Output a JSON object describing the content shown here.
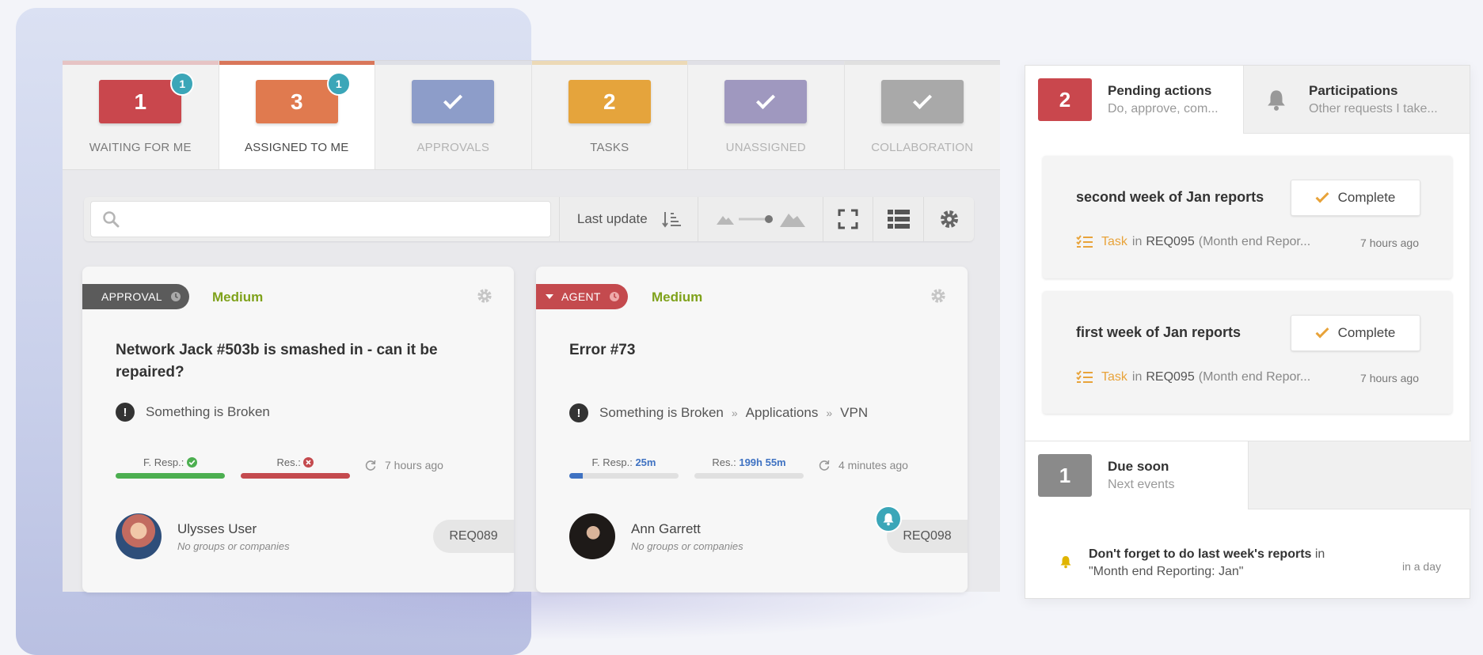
{
  "colors": {
    "waiting": "#c9474d",
    "assigned": "#e07a4f",
    "approvals": "#8d9dc9",
    "tasks": "#e5a43c",
    "unassigned": "#9f98bf",
    "collaboration": "#a9a9a9",
    "badge": "#3ba6b8",
    "priority_medium": "#7fa21b",
    "approval_pill": "#5b5b5b",
    "agent_pill": "#c44a4e"
  },
  "tabs": [
    {
      "label": "WAITING FOR ME",
      "value": "1",
      "badge": "1",
      "icon": null
    },
    {
      "label": "ASSIGNED TO ME",
      "value": "3",
      "badge": "1",
      "icon": null
    },
    {
      "label": "APPROVALS",
      "value": "",
      "badge": null,
      "icon": "check-icon"
    },
    {
      "label": "TASKS",
      "value": "2",
      "badge": null,
      "icon": null
    },
    {
      "label": "UNASSIGNED",
      "value": "",
      "badge": null,
      "icon": "check-icon"
    },
    {
      "label": "COLLABORATION",
      "value": "",
      "badge": null,
      "icon": "check-icon"
    }
  ],
  "toolbar": {
    "search_placeholder": "",
    "sort_label": "Last update"
  },
  "cards": [
    {
      "type": "APPROVAL",
      "priority": "Medium",
      "title": "Network Jack #503b is smashed in - can it be repaired?",
      "category": [
        "Something is Broken"
      ],
      "first_response": {
        "label": "F. Resp.:",
        "value": "",
        "status": "ok",
        "progress": 1.0
      },
      "resolution": {
        "label": "Res.:",
        "value": "",
        "status": "breached",
        "progress": 1.0
      },
      "updated": "7 hours ago",
      "user_name": "Ulysses User",
      "user_sub": "No groups or companies",
      "ref": "REQ089"
    },
    {
      "type": "AGENT",
      "priority": "Medium",
      "title": "Error #73",
      "category": [
        "Something is Broken",
        "Applications",
        "VPN"
      ],
      "first_response": {
        "label": "F. Resp.:",
        "value": "25m",
        "status": "running",
        "progress": 0.12
      },
      "resolution": {
        "label": "Res.:",
        "value": "199h 55m",
        "status": "running",
        "progress": 0.0
      },
      "updated": "4 minutes ago",
      "user_name": "Ann Garrett",
      "user_sub": "No groups or companies",
      "ref": "REQ098"
    }
  ],
  "right_panel": {
    "tabs": [
      {
        "count": "2",
        "title": "Pending actions",
        "subtitle": "Do, approve, com..."
      },
      {
        "count": "",
        "title": "Participations",
        "subtitle": "Other requests I take..."
      }
    ],
    "pending": [
      {
        "title": "second week of Jan reports",
        "button": "Complete",
        "kind": "Task",
        "in_word": "in",
        "ref": "REQ095",
        "ref_detail": "(Month end Repor...",
        "time": "7 hours ago"
      },
      {
        "title": "first week of Jan reports",
        "button": "Complete",
        "kind": "Task",
        "in_word": "in",
        "ref": "REQ095",
        "ref_detail": "(Month end Repor...",
        "time": "7 hours ago"
      }
    ],
    "due": {
      "count": "1",
      "title": "Due soon",
      "subtitle": "Next events",
      "event_bold": "Don't forget to do last week's reports",
      "event_rest": " in \"Month end Reporting: Jan\"",
      "event_time": "in a day"
    }
  }
}
